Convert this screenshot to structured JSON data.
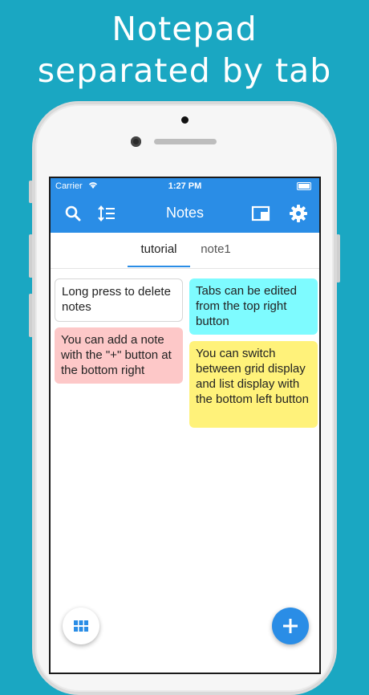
{
  "headline": {
    "line1": "Notepad",
    "line2": "separated by tab"
  },
  "status_bar": {
    "carrier": "Carrier",
    "time": "1:27 PM"
  },
  "app_bar": {
    "title": "Notes",
    "icons": [
      "search-icon",
      "sort-icon",
      "tab-edit-icon",
      "gear-icon"
    ]
  },
  "tabs": [
    {
      "label": "tutorial",
      "selected": true
    },
    {
      "label": "note1",
      "selected": false
    }
  ],
  "notes": [
    {
      "text": "Long press to delete notes",
      "color": "#ffffff"
    },
    {
      "text": "You can add a note with the \"+\" button at the bottom right",
      "color": "#fdc8c8"
    },
    {
      "text": "Tabs can be edited from the top right button",
      "color": "#7efbff"
    },
    {
      "text": "You can switch between grid display and list display with the bottom left button",
      "color": "#fff27a"
    }
  ],
  "colors": {
    "background": "#1aa7c2",
    "accent": "#2a8de6"
  },
  "fabs": {
    "left_icon": "grid-icon",
    "right_icon": "plus-icon"
  }
}
